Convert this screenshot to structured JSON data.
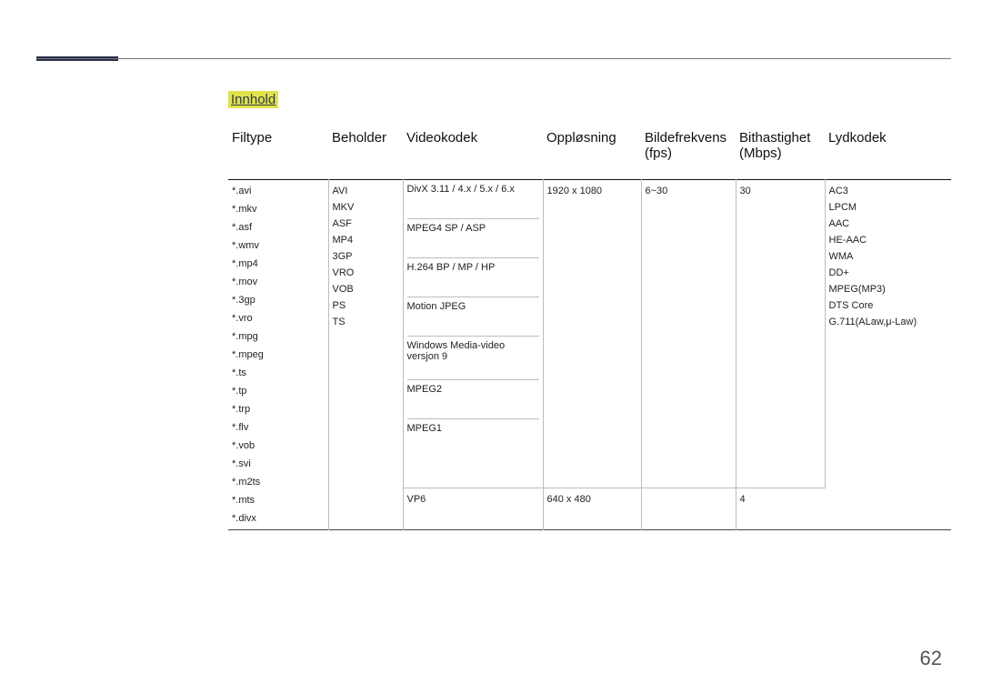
{
  "header": {
    "innhold": "Innhold"
  },
  "table": {
    "headers": {
      "filtype": "Filtype",
      "beholder": "Beholder",
      "videokodek": "Videokodek",
      "opplosning": "Oppløsning",
      "bildefrekvens": "Bildefrekvens (fps)",
      "bithastighet": "Bithastighet (Mbps)",
      "lydkodek": "Lydkodek"
    },
    "filtype": [
      "*.avi",
      "*.mkv",
      "*.asf",
      "*.wmv",
      "*.mp4",
      "*.mov",
      "*.3gp",
      "*.vro",
      "*.mpg",
      "*.mpeg",
      "*.ts",
      "*.tp",
      "*.trp",
      "*.flv",
      "*.vob",
      "*.svi",
      "*.m2ts",
      "*.mts",
      "*.divx"
    ],
    "beholder": [
      "AVI",
      "MKV",
      "ASF",
      "MP4",
      "3GP",
      "VRO",
      "VOB",
      "PS",
      "TS"
    ],
    "videokodek": {
      "main": [
        "DivX 3.11 / 4.x / 5.x / 6.x",
        "MPEG4 SP / ASP",
        "H.264 BP / MP / HP",
        "Motion JPEG",
        "Windows Media-video versjon 9",
        "MPEG2",
        "MPEG1"
      ],
      "vp6": "VP6"
    },
    "rows": {
      "r1": {
        "opplosning": "1920 x 1080",
        "fps": "6~30",
        "mbps": "30"
      },
      "r2": {
        "opplosning": "640 x 480",
        "fps": "",
        "mbps": "4"
      }
    },
    "lydkodek": [
      "AC3",
      "LPCM",
      "AAC",
      "HE-AAC",
      "WMA",
      "DD+",
      "MPEG(MP3)",
      "DTS Core",
      "G.711(ALaw,μ-Law)"
    ]
  },
  "page_number": "62"
}
